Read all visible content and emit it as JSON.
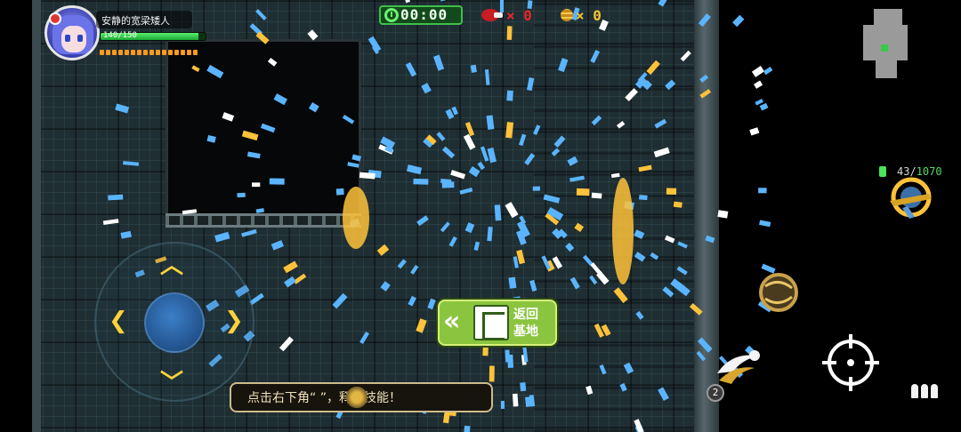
{
  "player": {
    "name": "安静的宽梁矮人",
    "hp_text": "140/150",
    "hp_fraction": 0.93,
    "energy_pips": 16
  },
  "stats": {
    "timer": "00:00",
    "kills": "× 0",
    "coins": "× 0"
  },
  "weapon": {
    "ammo_current": "43",
    "ammo_max": "1070"
  },
  "return_button": {
    "chevrons": "«",
    "label_line1": "返回",
    "label_line2": "基地"
  },
  "tip": {
    "text": "点击右下角“      ”，释放技能！"
  },
  "skill": {
    "charges": "2"
  },
  "colors": {
    "hp": "#2fd14a",
    "kill": "#e8262b",
    "coin": "#f4c430",
    "timer_border": "#3fbf4a",
    "return_button": "#8bc540",
    "ammo_max": "#56d862",
    "effect_blue": "#5ab4ff",
    "effect_gold": "#ffc23a"
  },
  "icons": {
    "timer": "clock-icon",
    "kills": "kill-icon",
    "coins": "coin-icon",
    "joystick_arrows": [
      "chevron-up-icon",
      "chevron-down-icon",
      "chevron-left-icon",
      "chevron-right-icon"
    ],
    "aim": "crosshair-icon",
    "skill": "dash-skill-icon",
    "bullets": "bullets-icon"
  }
}
